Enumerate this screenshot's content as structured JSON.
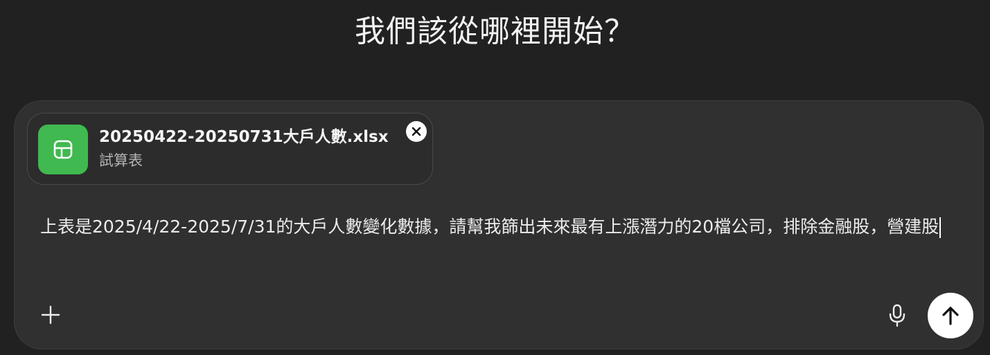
{
  "heading": "我們該從哪裡開始？",
  "attachment": {
    "file_name": "20250422-20250731大戶人數.xlsx",
    "file_type": "試算表",
    "icon": "spreadsheet-icon",
    "icon_color": "#3fb950"
  },
  "composer": {
    "prompt_text": "上表是2025/4/22-2025/7/31的大戶人數變化數據，請幫我篩出未來最有上漲潛力的20檔公司，排除金融股，營建股"
  },
  "icons": {
    "remove": "close-icon",
    "add": "plus-icon",
    "voice": "microphone-icon",
    "send": "arrow-up-icon"
  },
  "colors": {
    "background": "#212121",
    "composer_bg": "#303030",
    "send_button": "#ffffff"
  }
}
